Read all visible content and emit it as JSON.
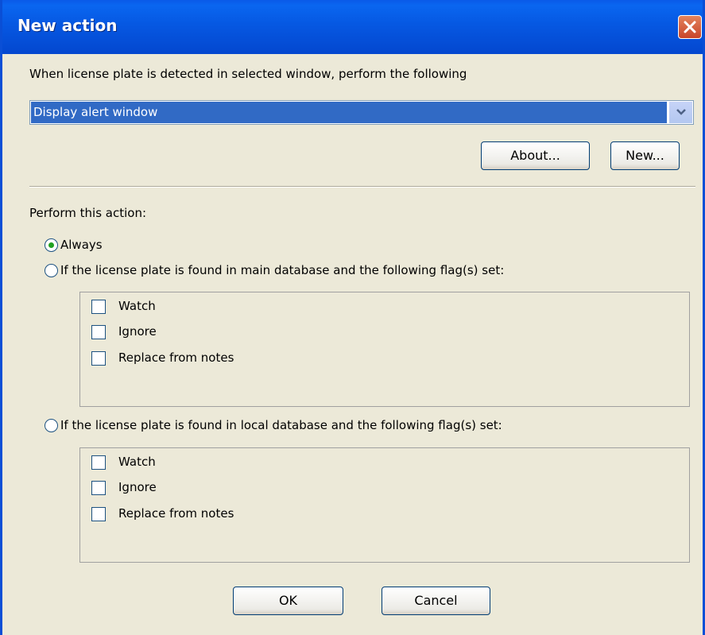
{
  "window": {
    "title": "New action"
  },
  "intro": {
    "text": "When license plate is detected in selected window, perform the following"
  },
  "action_select": {
    "selected": "Display alert window"
  },
  "buttons": {
    "about": "About...",
    "new": "New...",
    "ok": "OK",
    "cancel": "Cancel"
  },
  "perform": {
    "label": "Perform this action:",
    "options": [
      {
        "label": "Always",
        "selected": true
      },
      {
        "label": "If the license plate is found in main database and the following flag(s) set:",
        "selected": false
      },
      {
        "label": "If the license plate is found in local database and the following flag(s) set:",
        "selected": false
      }
    ]
  },
  "main_flags": [
    {
      "label": "Watch",
      "checked": false
    },
    {
      "label": "Ignore",
      "checked": false
    },
    {
      "label": "Replace from notes",
      "checked": false
    }
  ],
  "local_flags": [
    {
      "label": "Watch",
      "checked": false
    },
    {
      "label": "Ignore",
      "checked": false
    },
    {
      "label": "Replace from notes",
      "checked": false
    }
  ],
  "colors": {
    "titlebar": "#0a5ae8",
    "selection": "#316ac5",
    "dialog_bg": "#ece9d8",
    "radio_dot": "#21a121",
    "close_button": "#c8452a"
  },
  "icons": {
    "close": "close-icon",
    "dropdown": "chevron-down-icon"
  }
}
